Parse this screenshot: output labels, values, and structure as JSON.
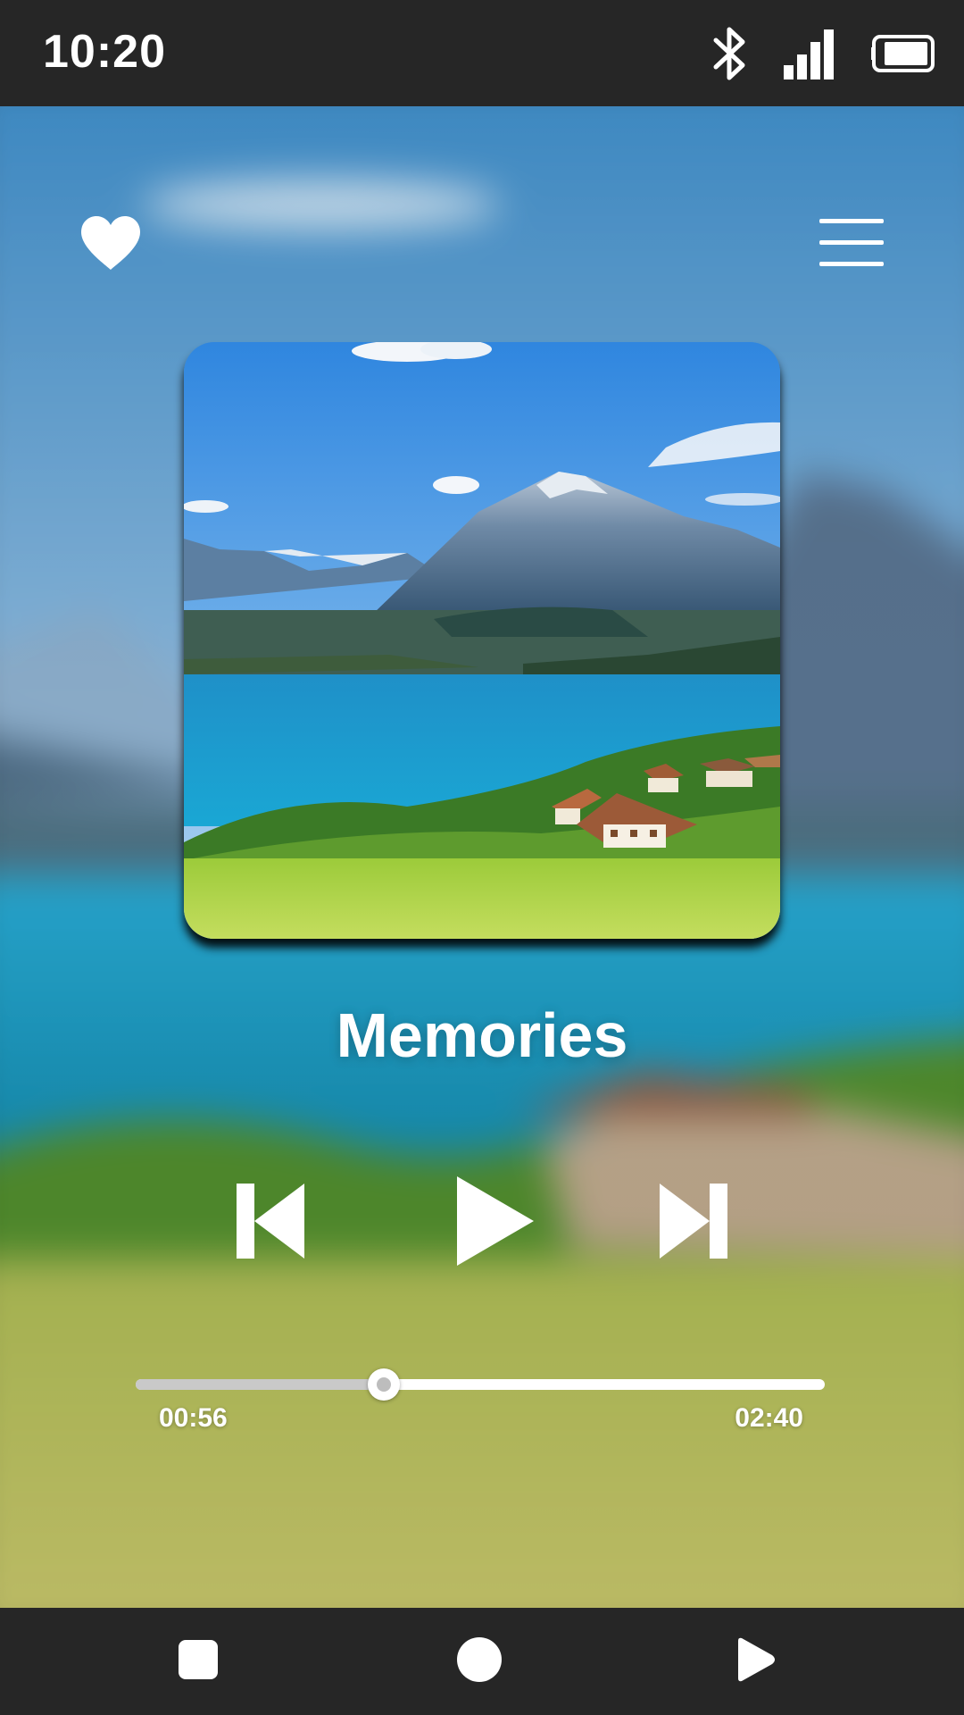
{
  "status_bar": {
    "time": "10:20",
    "icons": [
      "bluetooth-icon",
      "signal-icon",
      "battery-icon"
    ]
  },
  "player": {
    "liked": true,
    "track_title": "Memories",
    "elapsed": "00:56",
    "duration": "02:40",
    "progress_fraction": 0.36,
    "state": "paused"
  },
  "icons": {
    "like": "heart-icon",
    "menu": "menu-icon",
    "previous": "skip-previous-icon",
    "play": "play-icon",
    "next": "skip-next-icon"
  },
  "nav_bar": {
    "buttons": [
      "recents-square-icon",
      "home-circle-icon",
      "back-triangle-icon"
    ]
  },
  "colors": {
    "bar_background": "#262626",
    "foreground": "#ffffff",
    "progress_fill": "#c9c9c9"
  }
}
